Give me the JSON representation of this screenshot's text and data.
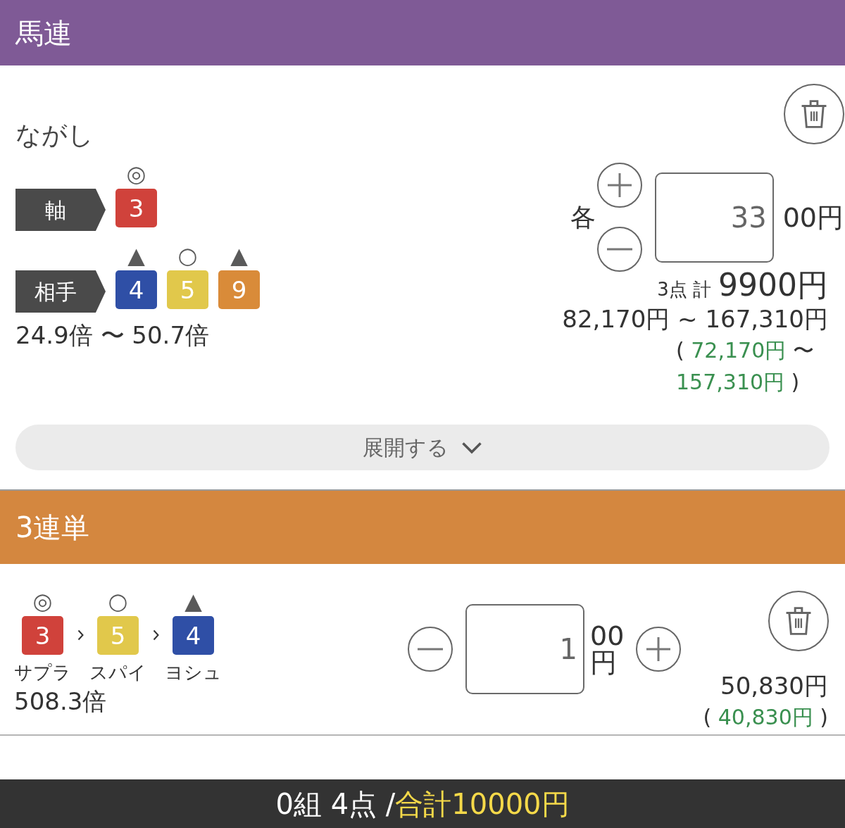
{
  "bets": [
    {
      "kind": "nagashi",
      "title": "馬連",
      "color": "#7f5a96",
      "method": "ながし",
      "groups": [
        {
          "label": "軸",
          "horses": [
            {
              "number": "3",
              "mark": "◎",
              "color": "#d0423b"
            }
          ]
        },
        {
          "label": "相手",
          "horses": [
            {
              "number": "4",
              "mark": "▲",
              "color": "#2f4fa6"
            },
            {
              "number": "5",
              "mark": "○",
              "color": "#e1c84b"
            },
            {
              "number": "9",
              "mark": "▲",
              "color": "#d98b39"
            }
          ]
        }
      ],
      "odds": "24.9倍 〜 50.7倍",
      "stake": {
        "prefix": "各",
        "value": "33",
        "unit": "00円"
      },
      "points": "3点 計",
      "total": "9900円",
      "payout": "82,170円 ~ 167,310円",
      "profit": {
        "open": "(",
        "values": [
          "72,170円",
          "157,310円"
        ],
        "separator": "〜",
        "close": ")"
      },
      "expand_button": "展開する"
    },
    {
      "kind": "single",
      "title": "3連単",
      "color": "#d4873f",
      "horses": [
        {
          "number": "3",
          "mark": "◎",
          "color": "#d0423b",
          "name": "サプラ"
        },
        {
          "number": "5",
          "mark": "○",
          "color": "#e1c84b",
          "name": "スパイ"
        },
        {
          "number": "4",
          "mark": "▲",
          "color": "#2f4fa6",
          "name": "ヨシュ"
        }
      ],
      "odds": "508.3倍",
      "stake": {
        "value": "1",
        "unit": "00円"
      },
      "payout": "50,830円",
      "profit": {
        "open": "(",
        "values": [
          "40,830円"
        ],
        "close": ")"
      }
    }
  ],
  "footer": {
    "summary": "0組 4点 /",
    "total": "合計10000円"
  }
}
